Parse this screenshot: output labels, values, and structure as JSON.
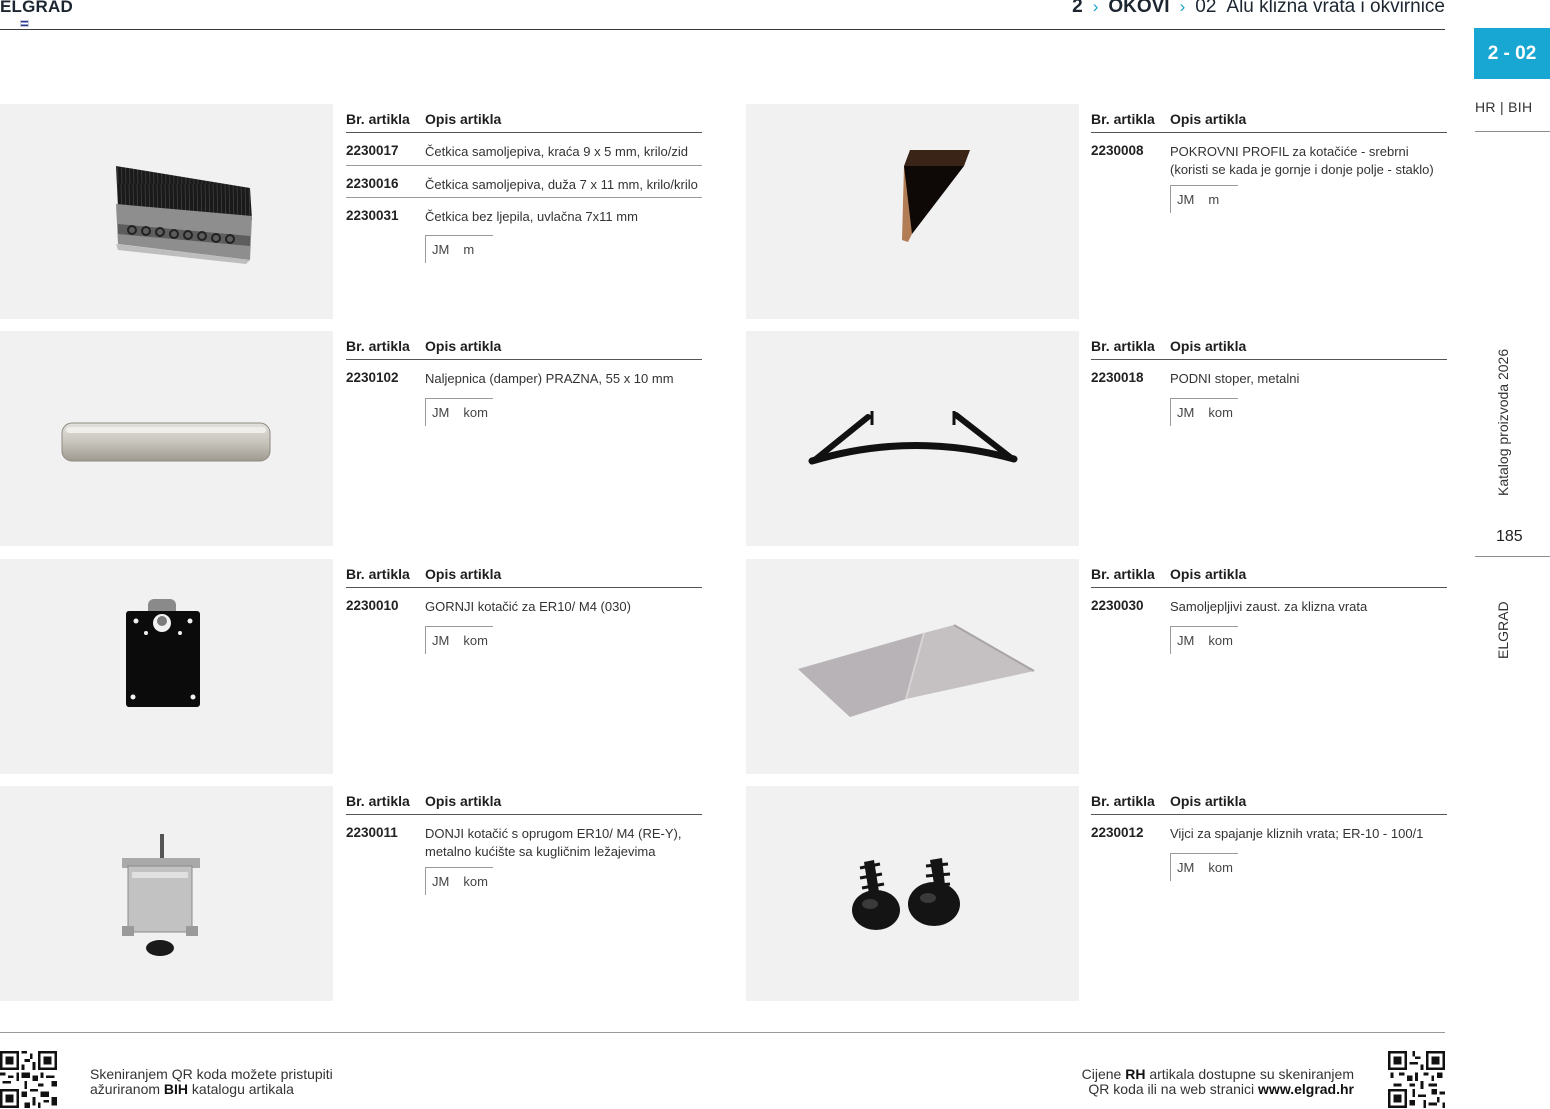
{
  "header": {
    "brand": "ELGRAD",
    "breadcrumb": {
      "chapter": "2",
      "category": "OKOVI",
      "section_num": "02",
      "section_title": "Alu klizna vrata i okvirnice"
    }
  },
  "rail": {
    "section_badge": "2 - 02",
    "language": "HR | BIH",
    "catalog_label": "Katalog proizvoda 2026",
    "page_number": "185",
    "brand_vertical": "ELGRAD"
  },
  "table_headers": {
    "code": "Br. artikla",
    "description": "Opis artikla"
  },
  "unit_label": "JM",
  "products": [
    {
      "rows": [
        {
          "code": "2230017",
          "description": "Četkica samoljepiva, kraća 9 x 5 mm, krilo/zid"
        },
        {
          "code": "2230016",
          "description": "Četkica samoljepiva, duža 7 x 11 mm, krilo/krilo"
        },
        {
          "code": "2230031",
          "description": "Četkica bez ljepila, uvlačna 7x11 mm"
        }
      ],
      "unit": "m",
      "image": "brush-seal-strip"
    },
    {
      "rows": [
        {
          "code": "2230008",
          "description": "POKROVNI PROFIL za kotačiće - srebrni (koristi se kada je gornje i donje polje - staklo)"
        }
      ],
      "unit": "m",
      "image": "cover-profile"
    },
    {
      "rows": [
        {
          "code": "2230102",
          "description": "Naljepnica (damper) PRAZNA, 55 x 10 mm"
        }
      ],
      "unit": "kom",
      "image": "damper-sticker"
    },
    {
      "rows": [
        {
          "code": "2230018",
          "description": "PODNI stoper, metalni"
        }
      ],
      "unit": "kom",
      "image": "floor-stopper"
    },
    {
      "rows": [
        {
          "code": "2230010",
          "description": "GORNJI kotačić za ER10/ M4 (030)"
        }
      ],
      "unit": "kom",
      "image": "top-roller-plate"
    },
    {
      "rows": [
        {
          "code": "2230030",
          "description": "Samoljepljivi zaust. za klizna vrata"
        }
      ],
      "unit": "kom",
      "image": "adhesive-pads"
    },
    {
      "rows": [
        {
          "code": "2230011",
          "description": "DONJI kotačić s oprugom ER10/ M4 (RE-Y), metalno kućište sa kugličnim ležajevima"
        }
      ],
      "unit": "kom",
      "image": "bottom-roller"
    },
    {
      "rows": [
        {
          "code": "2230012",
          "description": "Vijci za spajanje kliznih vrata; ER-10 - 100/1"
        }
      ],
      "unit": "kom",
      "image": "screws"
    }
  ],
  "footer": {
    "left_line1": "Skeniranjem QR koda možete pristupiti",
    "left_line2_pre": "ažuriranom ",
    "left_line2_bold": "BIH",
    "left_line2_post": " katalogu artikala",
    "right_line1_pre": "Cijene ",
    "right_line1_bold": "RH",
    "right_line1_post": " artikala dostupne su skeniranjem",
    "right_line2_pre": "QR koda ili na web stranici ",
    "right_line2_bold": "www.elgrad.hr"
  },
  "colors": {
    "accent": "#18a6d3",
    "photo_bg": "#f1f1f1",
    "text": "#222222"
  }
}
